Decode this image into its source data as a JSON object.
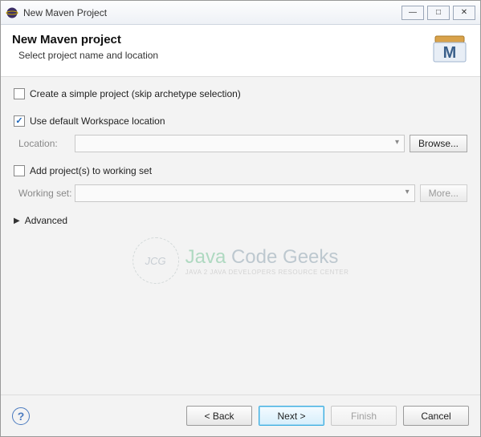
{
  "window": {
    "title": "New Maven Project"
  },
  "banner": {
    "title": "New Maven project",
    "subtitle": "Select project name and location"
  },
  "options": {
    "simple_project_label": "Create a simple project (skip archetype selection)",
    "use_default_workspace_label": "Use default Workspace location",
    "location_label": "Location:",
    "location_value": "",
    "browse_label": "Browse...",
    "add_to_working_set_label": "Add project(s) to working set",
    "working_set_label": "Working set:",
    "working_set_value": "",
    "more_label": "More...",
    "advanced_label": "Advanced"
  },
  "footer": {
    "back_label": "< Back",
    "next_label": "Next >",
    "finish_label": "Finish",
    "cancel_label": "Cancel"
  },
  "watermark": {
    "circle": "JCG",
    "main": "Java Code Geeks",
    "sub": "JAVA 2 JAVA DEVELOPERS RESOURCE CENTER"
  }
}
